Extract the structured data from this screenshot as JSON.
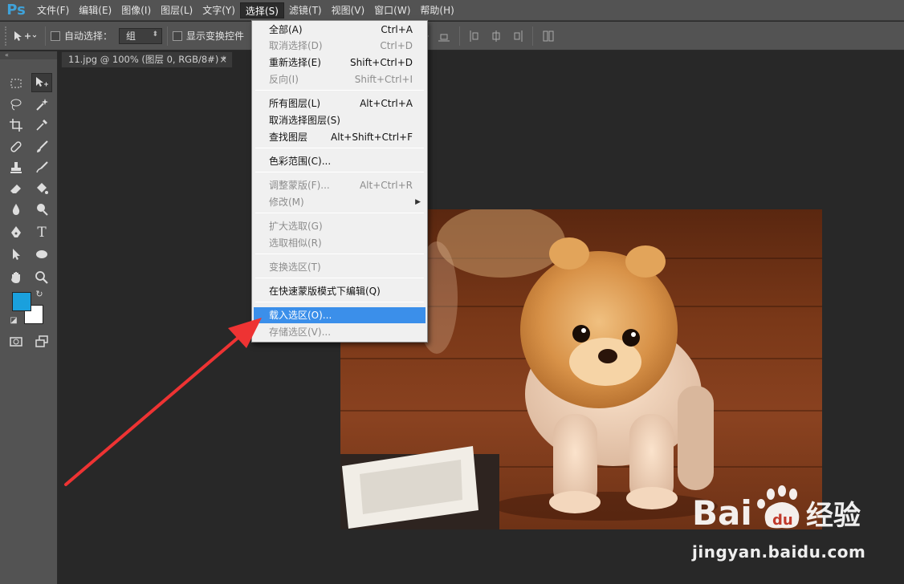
{
  "app": {
    "logo": "Ps"
  },
  "menubar": {
    "items": [
      "文件(F)",
      "编辑(E)",
      "图像(I)",
      "图层(L)",
      "文字(Y)",
      "选择(S)",
      "滤镜(T)",
      "视图(V)",
      "窗口(W)",
      "帮助(H)"
    ],
    "active": "选择(S)"
  },
  "options": {
    "auto_select_label": "自动选择：",
    "auto_select_value": "组",
    "show_transform_label": "显示变换控件"
  },
  "document": {
    "tab_title": "11.jpg @ 100% (图层 0, RGB/8#) *",
    "close_glyph": "×"
  },
  "colors": {
    "foreground": "#1aa0dd",
    "background": "#ffffff",
    "highlight": "#3b8fea",
    "arrow": "#ee3333"
  },
  "select_menu": {
    "items": [
      {
        "label": "全部(A)",
        "shortcut": "Ctrl+A",
        "enabled": true
      },
      {
        "label": "取消选择(D)",
        "shortcut": "Ctrl+D",
        "enabled": false
      },
      {
        "label": "重新选择(E)",
        "shortcut": "Shift+Ctrl+D",
        "enabled": true
      },
      {
        "label": "反向(I)",
        "shortcut": "Shift+Ctrl+I",
        "enabled": false
      },
      {
        "label": "所有图层(L)",
        "shortcut": "Alt+Ctrl+A",
        "enabled": true
      },
      {
        "label": "取消选择图层(S)",
        "shortcut": "",
        "enabled": true
      },
      {
        "label": "查找图层",
        "shortcut": "Alt+Shift+Ctrl+F",
        "enabled": true
      },
      {
        "label": "色彩范围(C)...",
        "shortcut": "",
        "enabled": true
      },
      {
        "label": "调整蒙版(F)...",
        "shortcut": "Alt+Ctrl+R",
        "enabled": false
      },
      {
        "label": "修改(M)",
        "shortcut": "",
        "enabled": false,
        "submenu": true
      },
      {
        "label": "扩大选取(G)",
        "shortcut": "",
        "enabled": false
      },
      {
        "label": "选取相似(R)",
        "shortcut": "",
        "enabled": false
      },
      {
        "label": "变换选区(T)",
        "shortcut": "",
        "enabled": false
      },
      {
        "label": "在快速蒙版模式下编辑(Q)",
        "shortcut": "",
        "enabled": true
      },
      {
        "label": "载入选区(O)...",
        "shortcut": "",
        "enabled": true,
        "highlighted": true
      },
      {
        "label": "存储选区(V)...",
        "shortcut": "",
        "enabled": false
      }
    ]
  },
  "watermark": {
    "brand": "Bai du 经验",
    "url": "jingyan.baidu.com"
  }
}
